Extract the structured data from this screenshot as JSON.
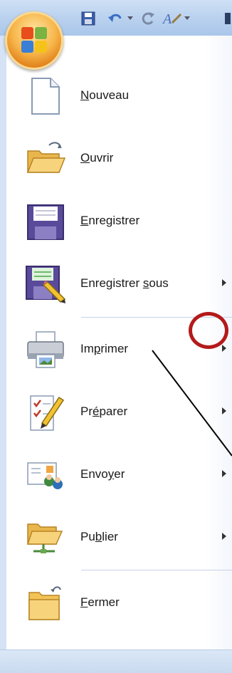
{
  "toolbar": {
    "icons": [
      "save-icon",
      "undo-icon",
      "redo-icon",
      "format-icon"
    ]
  },
  "menu": {
    "items": [
      {
        "id": "nouveau",
        "before": "",
        "key": "N",
        "after": "ouveau",
        "has_submenu": false,
        "icon": "new-document-icon"
      },
      {
        "id": "ouvrir",
        "before": "",
        "key": "O",
        "after": "uvrir",
        "has_submenu": false,
        "icon": "open-folder-icon"
      },
      {
        "id": "enregistrer",
        "before": "",
        "key": "E",
        "after": "nregistrer",
        "has_submenu": false,
        "icon": "save-disk-icon"
      },
      {
        "id": "enregistrer-sous",
        "before": "Enregistrer ",
        "key": "s",
        "after": "ous",
        "has_submenu": true,
        "icon": "save-as-icon"
      },
      {
        "id": "imprimer",
        "before": "Im",
        "key": "p",
        "after": "rimer",
        "has_submenu": true,
        "icon": "printer-icon"
      },
      {
        "id": "preparer",
        "before": "Pr",
        "key": "é",
        "after": "parer",
        "has_submenu": true,
        "icon": "prepare-icon"
      },
      {
        "id": "envoyer",
        "before": "Envo",
        "key": "y",
        "after": "er",
        "has_submenu": true,
        "icon": "send-icon"
      },
      {
        "id": "publier",
        "before": "Pu",
        "key": "b",
        "after": "lier",
        "has_submenu": true,
        "icon": "publish-icon"
      },
      {
        "id": "fermer",
        "before": "",
        "key": "F",
        "after": "ermer",
        "has_submenu": false,
        "icon": "close-folder-icon"
      }
    ]
  },
  "colors": {
    "annotation": "#b41a1a",
    "accent": "#f7b64a",
    "title_bar": "#bcd3ef"
  }
}
